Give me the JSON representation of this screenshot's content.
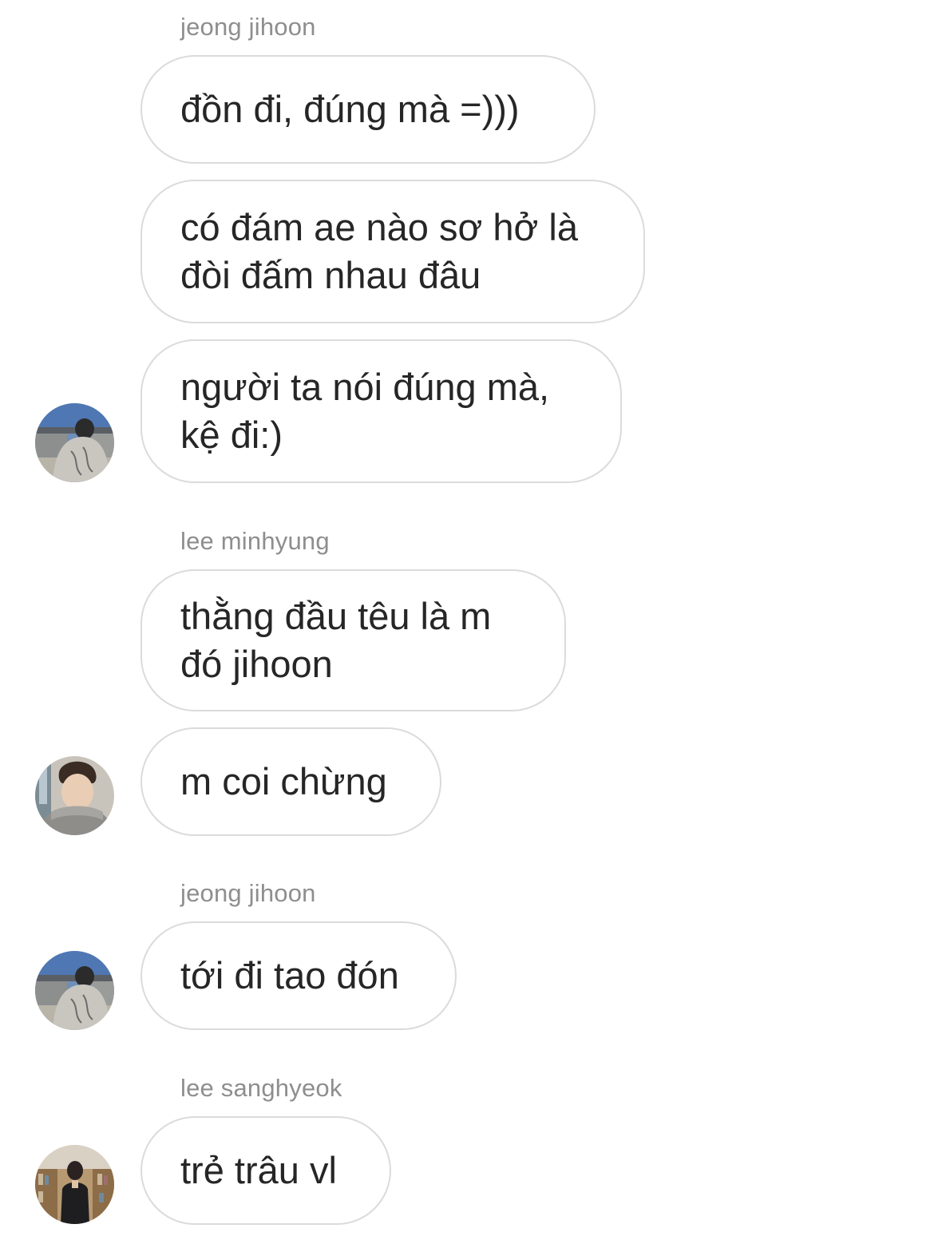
{
  "conversation": {
    "groups": [
      {
        "sender": "jeong jihoon",
        "messages": [
          "đồn đi, đúng mà =)))",
          "có đám ae nào sơ hở là đòi đấm nhau đâu",
          "người ta nói đúng mà, kệ đi:)"
        ],
        "avatar_icon": "profile-photo-back-view-icon"
      },
      {
        "sender": "lee minhyung",
        "messages": [
          "thằng đầu têu là m đó jihoon",
          "m coi chừng"
        ],
        "avatar_icon": "profile-photo-face-icon"
      },
      {
        "sender": "jeong jihoon",
        "messages": [
          "tới đi tao đón"
        ],
        "avatar_icon": "profile-photo-back-view-icon"
      },
      {
        "sender": "lee sanghyeok",
        "messages": [
          "trẻ trâu vl"
        ],
        "avatar_icon": "profile-photo-library-icon"
      }
    ]
  },
  "colors": {
    "background": "#ffffff",
    "bubble_border": "#dbdbdb",
    "message_text": "#262626",
    "sender_text": "#8e8e8e"
  }
}
